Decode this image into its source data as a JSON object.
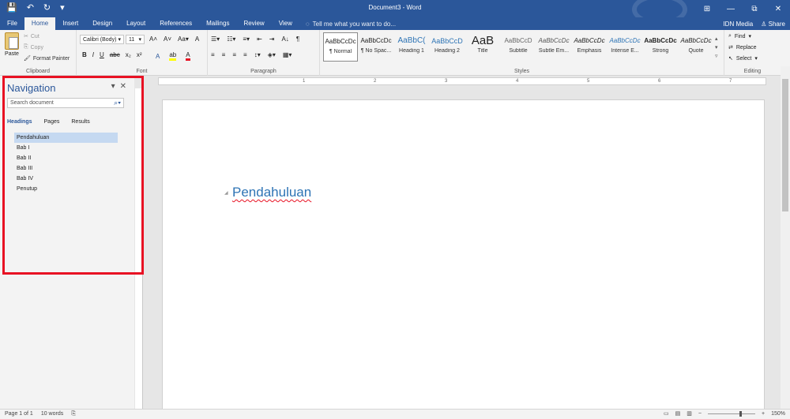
{
  "window": {
    "title": "Document3 - Word",
    "controls": [
      "⊞",
      "—",
      "⧉",
      "✕"
    ]
  },
  "qat": {
    "save": "💾",
    "undo": "↶",
    "redo": "↻",
    "more": "▾"
  },
  "tabs": [
    "File",
    "Home",
    "Insert",
    "Design",
    "Layout",
    "References",
    "Mailings",
    "Review",
    "View"
  ],
  "tellme": "Tell me what you want to do...",
  "account": {
    "user": "IDN Media",
    "share": "Share"
  },
  "clipboard": {
    "paste": "Paste",
    "cut": "Cut",
    "copy": "Copy",
    "painter": "Format Painter",
    "label": "Clipboard"
  },
  "font": {
    "family": "Calibri (Body)",
    "size": "11",
    "label": "Font",
    "grow": "A˄",
    "shrink": "A˅",
    "case": "Aa▾",
    "clear": "A"
  },
  "format_buttons": [
    "B",
    "I",
    "U",
    "abc",
    "x₂",
    "x²"
  ],
  "color_buttons": [
    "A",
    "ab",
    "A"
  ],
  "paragraph": {
    "label": "Paragraph",
    "row1": [
      "☰▾",
      "☷▾",
      "≡▾",
      "⇤",
      "⇥",
      "A↓",
      "¶"
    ],
    "row2": [
      "≡",
      "≡",
      "≡",
      "≡",
      "↕▾",
      "◈▾",
      "▦▾"
    ]
  },
  "styles": {
    "label": "Styles",
    "items": [
      {
        "preview": "AaBbCcDc",
        "name": "¶ Normal"
      },
      {
        "preview": "AaBbCcDc",
        "name": "¶ No Spac..."
      },
      {
        "preview": "AaBbC(",
        "name": "Heading 1"
      },
      {
        "preview": "AaBbCcD",
        "name": "Heading 2"
      },
      {
        "preview": "AaB",
        "name": "Title"
      },
      {
        "preview": "AaBbCcD",
        "name": "Subtitle"
      },
      {
        "preview": "AaBbCcDc",
        "name": "Subtle Em..."
      },
      {
        "preview": "AaBbCcDc",
        "name": "Emphasis"
      },
      {
        "preview": "AaBbCcDc",
        "name": "Intense E..."
      },
      {
        "preview": "AaBbCcDc",
        "name": "Strong"
      },
      {
        "preview": "AaBbCcDc",
        "name": "Quote"
      }
    ]
  },
  "editing": {
    "find": "Find",
    "replace": "Replace",
    "select": "Select",
    "label": "Editing"
  },
  "navigation": {
    "title": "Navigation",
    "search_placeholder": "Search document",
    "tabs": [
      "Headings",
      "Pages",
      "Results"
    ],
    "headings": [
      "Pendahuluan",
      "Bab I",
      "Bab II",
      "Bab III",
      "Bab IV",
      "Penutup"
    ]
  },
  "ruler": [
    "1",
    "2",
    "3",
    "4",
    "5",
    "6",
    "7"
  ],
  "document": {
    "heading": "Pendahuluan"
  },
  "status": {
    "page": "Page 1 of 1",
    "words": "10 words",
    "zoom": "150%"
  },
  "colors": {
    "brand": "#2b579a",
    "heading": "#2e74b5",
    "highlight": "#e81123"
  }
}
